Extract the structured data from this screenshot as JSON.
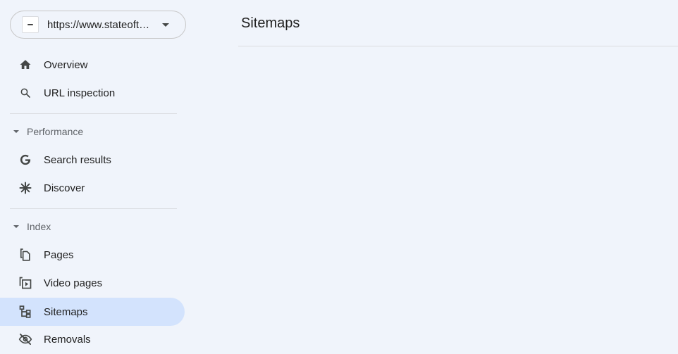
{
  "property": {
    "url": "https://www.stateofthedapps.com/"
  },
  "nav": {
    "overview": "Overview",
    "url_inspection": "URL inspection",
    "performance_header": "Performance",
    "search_results": "Search results",
    "discover": "Discover",
    "index_header": "Index",
    "pages": "Pages",
    "video_pages": "Video pages",
    "sitemaps": "Sitemaps",
    "removals": "Removals",
    "active_item": "Sitemaps"
  },
  "main": {
    "title": "Sitemaps"
  },
  "icons": {
    "overview": "home-icon",
    "url_inspection": "search-icon",
    "search_results": "google-g-icon",
    "discover": "asterisk-icon",
    "pages": "pages-icon",
    "video_pages": "video-pages-icon",
    "sitemaps": "sitemap-tree-icon",
    "removals": "eye-off-icon"
  },
  "colors": {
    "background": "#f0f4fb",
    "active_item": "#d3e3fd",
    "icon": "#444746",
    "muted_text": "#5f6368"
  }
}
